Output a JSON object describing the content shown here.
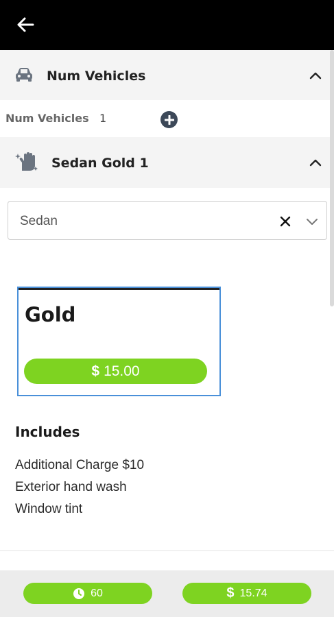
{
  "header": {
    "back_icon": "arrow-left-icon"
  },
  "vehicles_section": {
    "icon": "car-icon",
    "title": "Num Vehicles",
    "count_label": "Num Vehicles",
    "count_value": "1",
    "add_icon": "plus-circle-icon",
    "chevron_icon": "chevron-up-icon"
  },
  "service_section": {
    "icon": "hand-sparkle-icon",
    "title": "Sedan Gold 1",
    "chevron_icon": "chevron-up-icon",
    "vehicle_type_select": {
      "value": "Sedan",
      "clear_icon": "close-icon",
      "dropdown_icon": "chevron-down-icon"
    }
  },
  "package_card": {
    "title": "Gold",
    "price_symbol": "$",
    "price": "15.00"
  },
  "includes": {
    "title": "Includes",
    "items": [
      "Additional Charge $10",
      "Exterior hand wash",
      "Window tint"
    ]
  },
  "footer": {
    "duration_icon": "clock-icon",
    "duration": "60",
    "total_symbol": "$",
    "total": "15.74"
  },
  "colors": {
    "accent_green": "#7ed321",
    "header_black": "#000000",
    "selected_border": "#4a90d9",
    "section_bg": "#f4f4f4"
  }
}
